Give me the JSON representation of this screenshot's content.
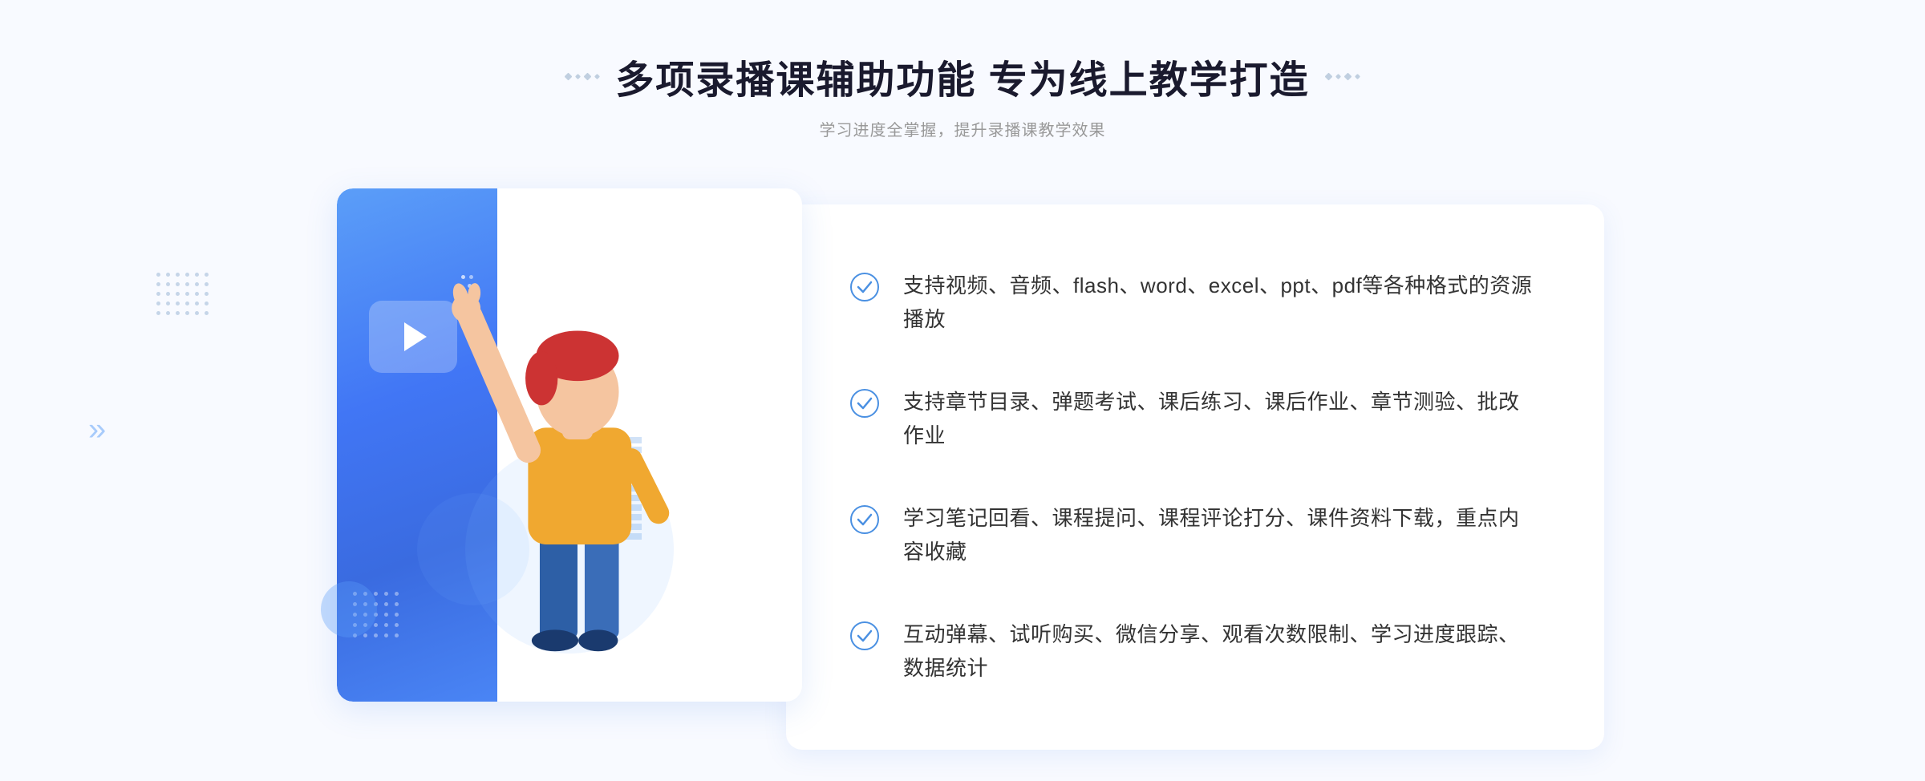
{
  "header": {
    "title": "多项录播课辅助功能 专为线上教学打造",
    "subtitle": "学习进度全掌握，提升录播课教学效果"
  },
  "features": [
    {
      "id": 1,
      "text": "支持视频、音频、flash、word、excel、ppt、pdf等各种格式的资源播放"
    },
    {
      "id": 2,
      "text": "支持章节目录、弹题考试、课后练习、课后作业、章节测验、批改作业"
    },
    {
      "id": 3,
      "text": "学习笔记回看、课程提问、课程评论打分、课件资料下载，重点内容收藏"
    },
    {
      "id": 4,
      "text": "互动弹幕、试听购买、微信分享、观看次数限制、学习进度跟踪、数据统计"
    }
  ],
  "decorations": {
    "chevron_left": "»",
    "play_icon": "▶"
  }
}
